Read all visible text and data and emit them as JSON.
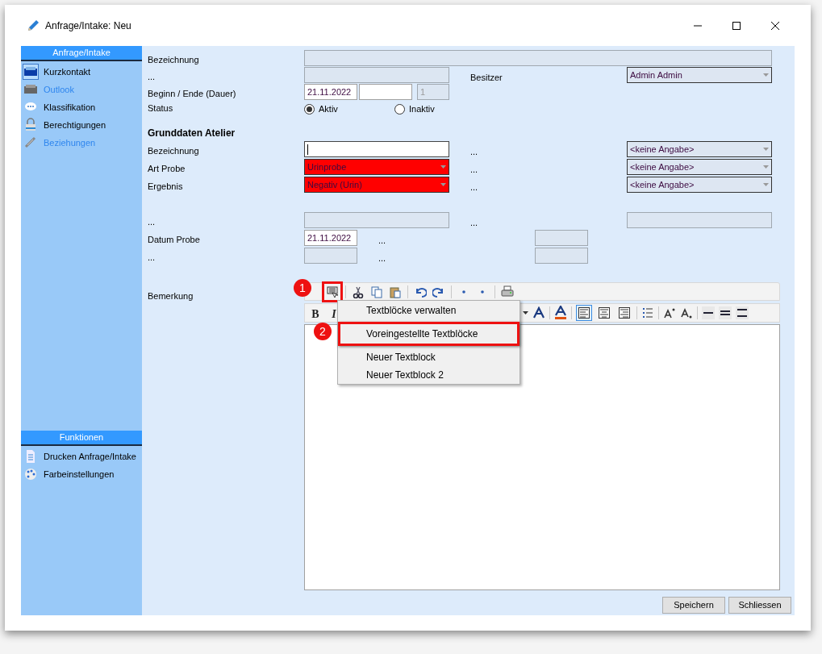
{
  "window": {
    "title": "Anfrage/Intake: Neu"
  },
  "sidebar": {
    "sections": [
      {
        "title": "Anfrage/Intake",
        "items": [
          {
            "label": "Kurzkontakt",
            "selected": true,
            "disabled": false
          },
          {
            "label": "Outlook",
            "selected": false,
            "disabled": true
          },
          {
            "label": "Klassifikation",
            "selected": false,
            "disabled": false
          },
          {
            "label": "Berechtigungen",
            "selected": false,
            "disabled": false
          },
          {
            "label": "Beziehungen",
            "selected": false,
            "disabled": true
          }
        ]
      },
      {
        "title": "Funktionen",
        "items": [
          {
            "label": "Drucken Anfrage/Intake",
            "selected": false,
            "disabled": false
          },
          {
            "label": "Farbeinstellungen",
            "selected": false,
            "disabled": false
          }
        ]
      }
    ]
  },
  "form": {
    "rows": [
      {
        "kind": "wide",
        "label": "Bezeichnung"
      },
      {
        "kind": "pair",
        "label": "...",
        "field": {
          "kind": "readonly"
        },
        "right_label": "Besitzer",
        "right_field": {
          "kind": "combo",
          "value": "Admin Admin"
        }
      },
      {
        "kind": "dates",
        "label": "Beginn / Ende (Dauer)",
        "start": "21.11.2022",
        "duration": "1"
      },
      {
        "kind": "radio",
        "label": "Status",
        "options": [
          {
            "label": "Aktiv",
            "selected": true
          },
          {
            "label": "Inaktiv",
            "selected": false
          }
        ]
      },
      {
        "kind": "heading",
        "label": "Grunddaten Atelier"
      },
      {
        "kind": "pair",
        "label": "Bezeichnung",
        "field": {
          "kind": "text"
        },
        "right_label": "...",
        "right_field": {
          "kind": "combo",
          "value": "<keine Angabe>"
        }
      },
      {
        "kind": "pair",
        "label": "Art Probe",
        "field": {
          "kind": "combo",
          "value": "Urinprobe",
          "color": "#ff0000"
        },
        "right_label": "...",
        "right_field": {
          "kind": "combo",
          "value": "<keine Angabe>"
        }
      },
      {
        "kind": "pair",
        "label": "Ergebnis",
        "field": {
          "kind": "combo",
          "value": "Negativ (Urin)",
          "color": "#ff0000"
        },
        "right_label": "...",
        "right_field": {
          "kind": "combo",
          "value": "<keine Angabe>"
        }
      },
      {
        "kind": "spacer"
      },
      {
        "kind": "pair",
        "label": "...",
        "field": {
          "kind": "readonly"
        },
        "right_label": "...",
        "right_field": {
          "kind": "readonly"
        }
      },
      {
        "kind": "pair",
        "label": "Datum Probe",
        "field": {
          "kind": "date",
          "value": "21.11.2022"
        },
        "right_label": "...",
        "right_field": {
          "kind": "short"
        }
      },
      {
        "kind": "pair",
        "label": "...",
        "field": {
          "kind": "short"
        },
        "right_label": "...",
        "right_field": {
          "kind": "short"
        }
      }
    ]
  },
  "remarks": {
    "label": "Bemerkung",
    "format_buttons": [
      "B",
      "I"
    ],
    "align_buttons": [
      {
        "selected": true
      },
      {
        "selected": false
      },
      {
        "selected": false
      }
    ],
    "text_block_button_highlighted": true
  },
  "menu": {
    "items": [
      {
        "kind": "item",
        "label": "Textblöcke verwalten",
        "highlighted": false
      },
      {
        "kind": "separator"
      },
      {
        "kind": "item",
        "label": "Voreingestellte Textblöcke",
        "highlighted": true
      },
      {
        "kind": "separator"
      },
      {
        "kind": "item",
        "label": "Neuer Textblock",
        "highlighted": false
      },
      {
        "kind": "item",
        "label": "Neuer Textblock 2",
        "highlighted": false
      }
    ]
  },
  "callouts": [
    {
      "label": "1"
    },
    {
      "label": "2"
    }
  ],
  "buttons": [
    "Speichern",
    "Schliessen"
  ]
}
